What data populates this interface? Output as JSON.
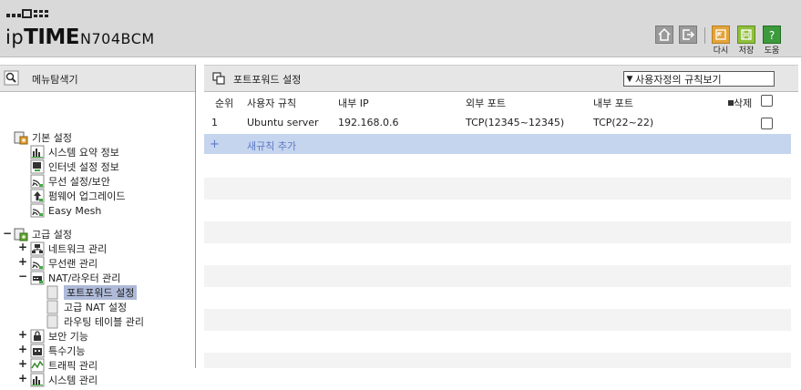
{
  "header": {
    "brand_ip": "ip",
    "brand_time": "TIME",
    "model": "N704BCM",
    "buttons": {
      "home": "home",
      "logout": "logout",
      "back_label": "다시",
      "save_label": "저장",
      "help_label": "도움"
    }
  },
  "sidebar": {
    "title": "메뉴탐색기",
    "groups": [
      {
        "label": "기본 설정",
        "items": [
          "시스템 요약 정보",
          "인터넷 설정 정보",
          "무선 설정/보안",
          "펌웨어 업그레이드",
          "Easy Mesh"
        ]
      },
      {
        "label": "고급 설정",
        "items": [
          {
            "label": "네트워크 관리"
          },
          {
            "label": "무선랜 관리"
          },
          {
            "label": "NAT/라우터 관리",
            "children": [
              "포트포워드 설정",
              "고급 NAT 설정",
              "라우팅 테이블 관리"
            ]
          },
          {
            "label": "보안 기능"
          },
          {
            "label": "특수기능"
          },
          {
            "label": "트래픽 관리"
          },
          {
            "label": "시스템 관리"
          }
        ]
      }
    ]
  },
  "main": {
    "title": "포트포워드 설정",
    "select_value": "사용자정의 규칙보기",
    "columns": {
      "index": "순위",
      "rule": "사용자 규칙",
      "internal_ip": "내부 IP",
      "external_port": "외부 포트",
      "internal_port": "내부 포트",
      "delete": "삭제"
    },
    "rows": [
      {
        "index": "1",
        "rule": "Ubuntu server",
        "internal_ip": "192.168.0.6",
        "external_port": "TCP(12345~12345)",
        "internal_port": "TCP(22~22)"
      }
    ],
    "add_icon": "+",
    "add_label": "새규칙 추가"
  },
  "colors": {
    "header_bg": "#d9d9d9",
    "accent_green": "#6aa83a",
    "accent_orange": "#e3a43a",
    "selected_bg": "#aebad8",
    "add_row_bg": "#c6d5ee"
  }
}
